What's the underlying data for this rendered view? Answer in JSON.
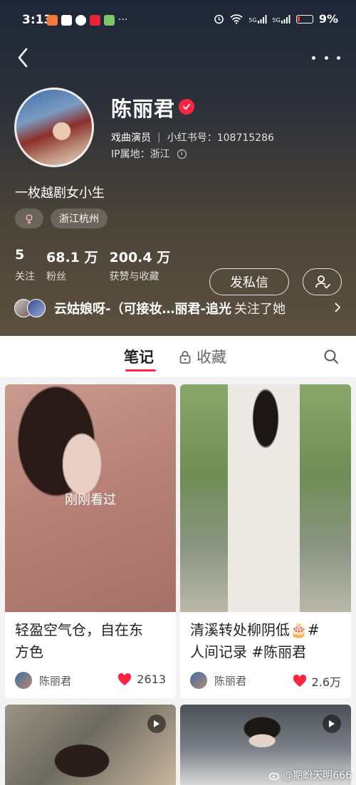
{
  "status_bar": {
    "time": "3:13",
    "more": "···",
    "signal_1": "5G",
    "signal_2": "5G",
    "battery": "9%"
  },
  "profile": {
    "name": "陈丽君",
    "occupation": "戏曲演员",
    "xhs_id": "小红书号：108715286",
    "ip": "IP属地：浙江",
    "bio": "一枚越剧女小生",
    "gender_icon": "♀",
    "location_tag": "浙江杭州"
  },
  "stats": [
    {
      "value": "5",
      "label": "关注"
    },
    {
      "value": "68.1 万",
      "label": "粉丝"
    },
    {
      "value": "200.4 万",
      "label": "获赞与收藏"
    }
  ],
  "actions": {
    "message_label": "发私信"
  },
  "followers_line": {
    "names": "云姑娘呀-（可接妆…丽君-追光",
    "suffix": "关注了她"
  },
  "tabs": {
    "notes": "笔记",
    "favorites": "收藏"
  },
  "notes": [
    {
      "title_line1": "轻盈空气仓，自在东",
      "title_line2": "方色",
      "overlay": "刚刚看过",
      "author": "陈丽君",
      "likes": "2613"
    },
    {
      "title_line1": "清溪转处柳阴低🎂#",
      "title_line2": "人间记录 #陈丽君",
      "author": "陈丽君",
      "likes": "2.6万"
    }
  ],
  "watermark": "@期盼天明666",
  "colors": {
    "accent": "#ff2442",
    "header_top": "#1d2736",
    "header_bottom": "#5d513f"
  }
}
